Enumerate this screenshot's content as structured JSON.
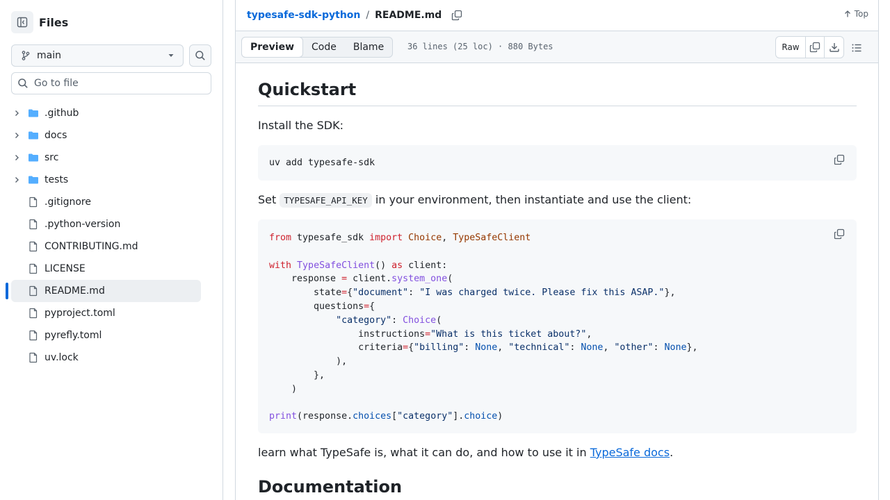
{
  "sidebar": {
    "title": "Files",
    "branch": "main",
    "goto_placeholder": "Go to file",
    "items": [
      {
        "name": ".github",
        "type": "folder"
      },
      {
        "name": "docs",
        "type": "folder"
      },
      {
        "name": "src",
        "type": "folder"
      },
      {
        "name": "tests",
        "type": "folder"
      },
      {
        "name": ".gitignore",
        "type": "file"
      },
      {
        "name": ".python-version",
        "type": "file"
      },
      {
        "name": "CONTRIBUTING.md",
        "type": "file"
      },
      {
        "name": "LICENSE",
        "type": "file"
      },
      {
        "name": "README.md",
        "type": "file",
        "active": true
      },
      {
        "name": "pyproject.toml",
        "type": "file"
      },
      {
        "name": "pyrefly.toml",
        "type": "file"
      },
      {
        "name": "uv.lock",
        "type": "file"
      }
    ]
  },
  "header": {
    "repo": "typesafe-sdk-python",
    "separator": "/",
    "file": "README.md",
    "top_label": "Top"
  },
  "filebar": {
    "tabs": [
      "Preview",
      "Code",
      "Blame"
    ],
    "selected_tab": "Preview",
    "meta": "36 lines (25 loc) · 880 Bytes",
    "raw_label": "Raw"
  },
  "readme": {
    "heading_quickstart": "Quickstart",
    "install_text": "Install the SDK:",
    "install_cmd": "uv add typesafe-sdk",
    "set_prefix": "Set",
    "env_var": "TYPESAFE_API_KEY",
    "set_suffix": "in your environment, then instantiate and use the client:",
    "learn_prefix": "learn what TypeSafe is, what it can do, and how to use it in",
    "learn_link": "TypeSafe docs",
    "learn_suffix": ".",
    "heading_docs": "Documentation"
  },
  "colors": {
    "accent": "#0969da",
    "keyword": "#cf222e",
    "class_name": "#953800",
    "function": "#8250df",
    "string": "#0a3069",
    "constant": "#0550ae"
  }
}
